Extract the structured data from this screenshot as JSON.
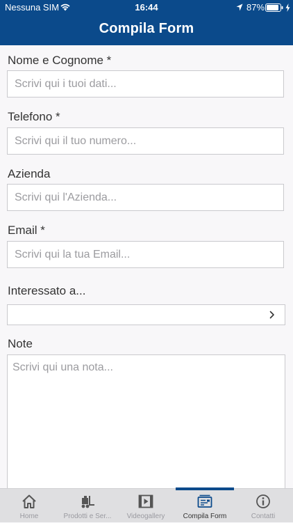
{
  "status_bar": {
    "carrier": "Nessuna SIM",
    "time": "16:44",
    "battery": "87%"
  },
  "nav": {
    "title": "Compila Form"
  },
  "form": {
    "name": {
      "label": "Nome e Cognome *",
      "placeholder": "Scrivi qui i tuoi dati..."
    },
    "phone": {
      "label": "Telefono *",
      "placeholder": "Scrivi qui il tuo numero..."
    },
    "company": {
      "label": "Azienda",
      "placeholder": "Scrivi qui l'Azienda..."
    },
    "email": {
      "label": "Email *",
      "placeholder": "Scrivi qui la tua Email..."
    },
    "interest": {
      "label": "Interessato a...",
      "value": ""
    },
    "note": {
      "label": "Note",
      "placeholder": "Scrivi qui una nota..."
    }
  },
  "tabbar": {
    "items": [
      {
        "label": "Home",
        "icon": "home-icon"
      },
      {
        "label": "Prodotti e Ser...",
        "icon": "forklift-icon"
      },
      {
        "label": "Videogallery",
        "icon": "video-icon"
      },
      {
        "label": "Compila Form",
        "icon": "form-icon"
      },
      {
        "label": "Contatti",
        "icon": "info-icon"
      }
    ],
    "active_index": 3
  },
  "colors": {
    "header": "#0b4a8b",
    "background": "#f8f7f9",
    "border": "#c9c9cd",
    "tab_inactive": "#9a9aa0"
  }
}
